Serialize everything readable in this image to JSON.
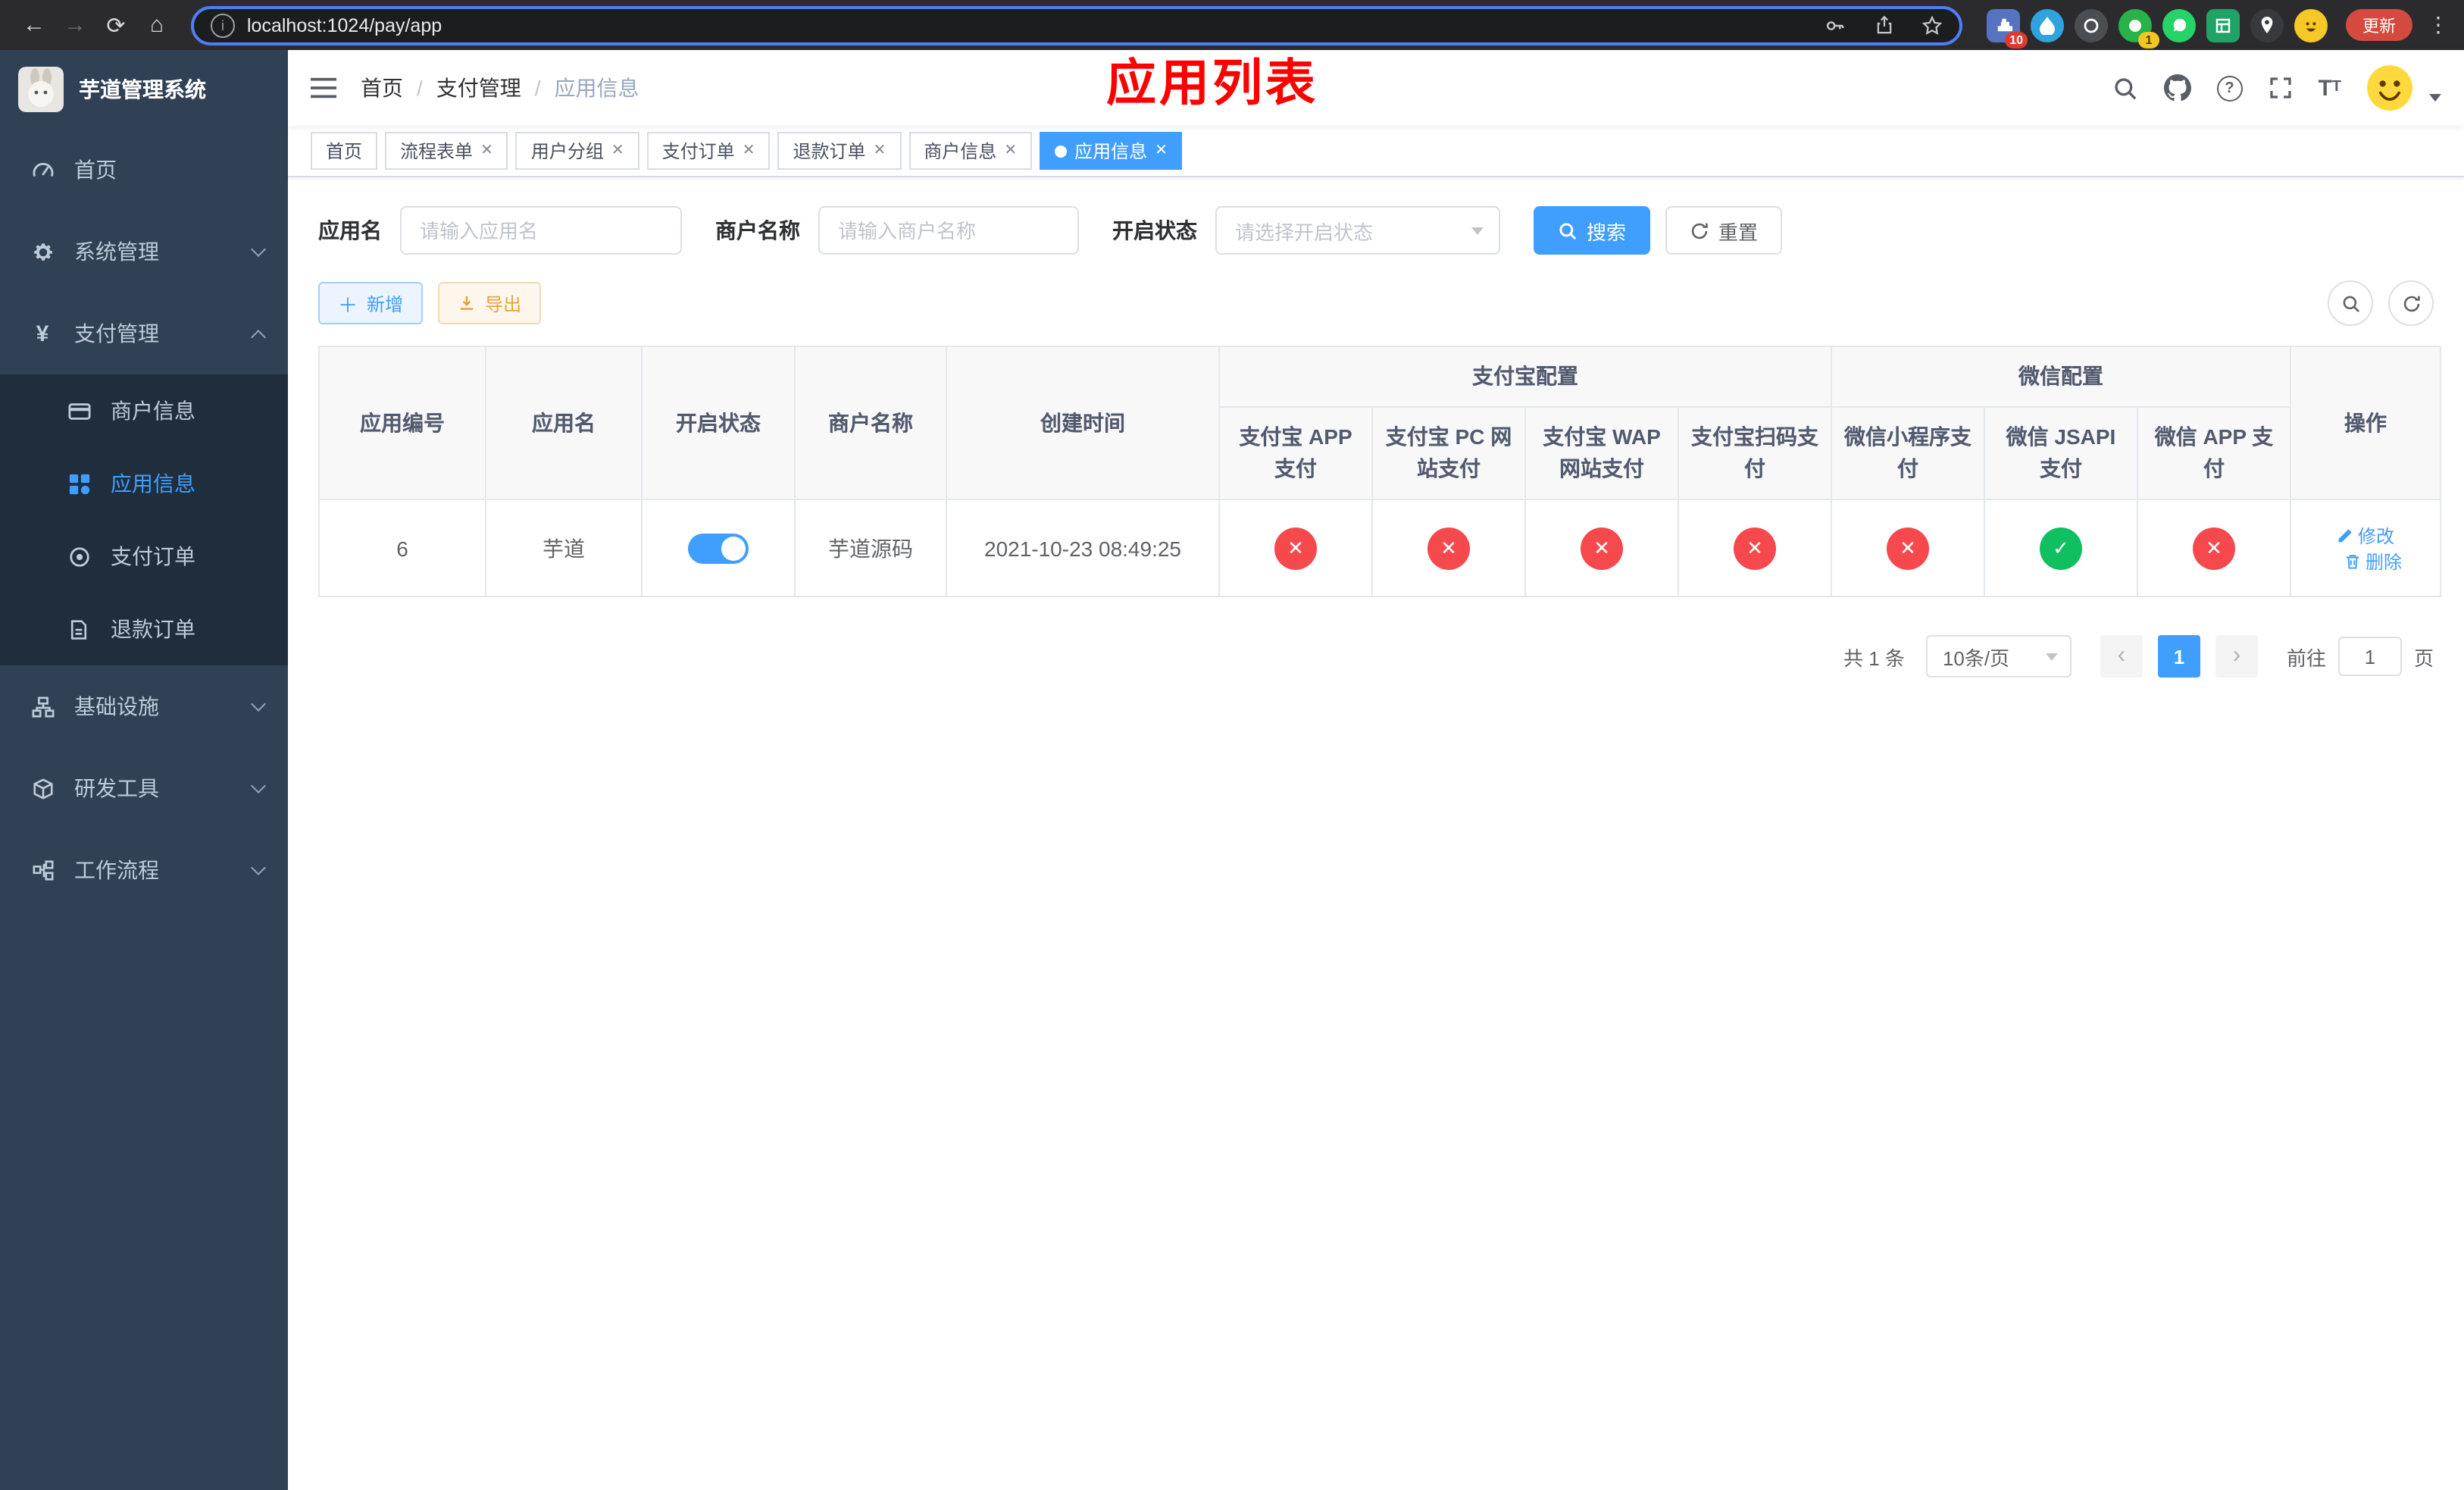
{
  "colors": {
    "primary": "#409EFF",
    "danger": "#f5494d",
    "success": "#0fbf60",
    "warning": "#e6a23c",
    "sidebarBg": "#304156",
    "submenuBg": "#1f2d3d",
    "sidebarText": "#bfcbd9",
    "annotation": "#ff0000",
    "chromeBg": "#2b2b2e",
    "updateBtn": "#d44a3f"
  },
  "browser": {
    "back_icon": "←",
    "forward_icon": "→",
    "reload_icon": "⟳",
    "home_icon": "⌂",
    "url": "localhost:1024/pay/app",
    "ext_badge_puzzle": "10",
    "ext_badge_green": "1",
    "update_button": "更新",
    "menu_icon": "⋮"
  },
  "sidebar": {
    "title": "芋道管理系统",
    "home": "首页",
    "system": "系统管理",
    "payment": "支付管理",
    "payment_icon": "¥",
    "merchant_info": "商户信息",
    "app_info": "应用信息",
    "pay_order": "支付订单",
    "refund_order": "退款订单",
    "infra": "基础设施",
    "dev_tools": "研发工具",
    "workflow": "工作流程"
  },
  "navbar": {
    "breadcrumb_home": "首页",
    "breadcrumb_section": "支付管理",
    "breadcrumb_current": "应用信息",
    "annotation": "应用列表"
  },
  "tabs": {
    "t0": "首页",
    "t1": "流程表单",
    "t2": "用户分组",
    "t3": "支付订单",
    "t4": "退款订单",
    "t5": "商户信息",
    "t6": "应用信息"
  },
  "filters": {
    "app_name_label": "应用名",
    "app_name_placeholder": "请输入应用名",
    "merchant_label": "商户名称",
    "merchant_placeholder": "请输入商户名称",
    "status_label": "开启状态",
    "status_placeholder": "请选择开启状态",
    "search_button": "搜索",
    "reset_button": "重置"
  },
  "toolbar": {
    "add_button": "新增",
    "export_button": "导出"
  },
  "table": {
    "headers": {
      "app_id": "应用编号",
      "app_name": "应用名",
      "status": "开启状态",
      "merchant": "商户名称",
      "created": "创建时间",
      "alipay_group": "支付宝配置",
      "wechat_group": "微信配置",
      "alipay_app": "支付宝 APP 支付",
      "alipay_pc": "支付宝 PC 网站支付",
      "alipay_wap": "支付宝 WAP 网站支付",
      "alipay_qr": "支付宝扫码支付",
      "wx_mini": "微信小程序支付",
      "wx_jsapi": "微信 JSAPI 支付",
      "wx_app": "微信 APP 支付",
      "actions": "操作"
    },
    "row": {
      "id": "6",
      "name": "芋道",
      "enabled": true,
      "merchant": "芋道源码",
      "created": "2021-10-23 08:49:25",
      "configs": [
        "no",
        "no",
        "no",
        "no",
        "no",
        "yes",
        "no"
      ],
      "edit_label": "修改",
      "delete_label": "删除"
    }
  },
  "pagination": {
    "total": "共 1 条",
    "page_size": "10条/页",
    "page": "1",
    "goto_label": "前往",
    "goto_value": "1",
    "unit_label": "页"
  }
}
